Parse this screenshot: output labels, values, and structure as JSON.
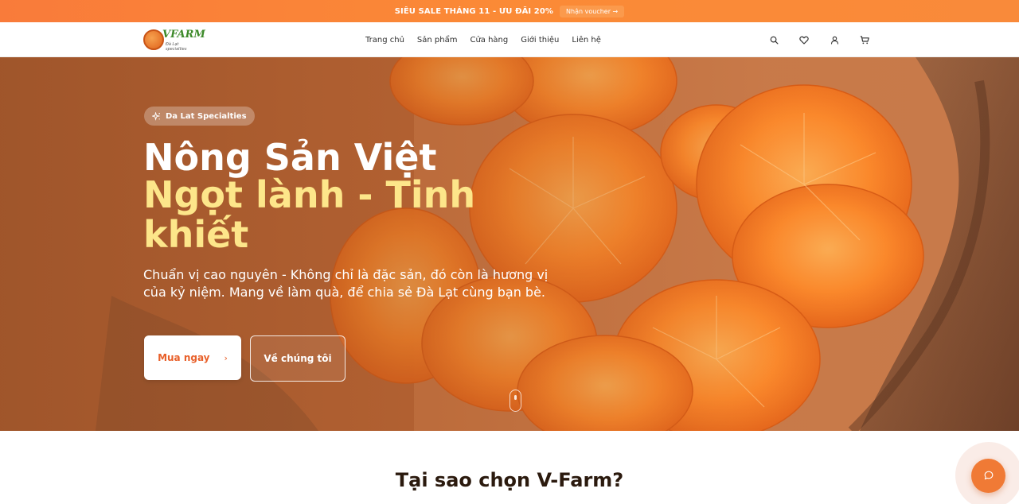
{
  "promo": {
    "text": "SIÊU SALE THÁNG 11 - ƯU ĐÃI 20%",
    "button_label": "Nhận voucher →"
  },
  "header": {
    "logo_word": "VFARM",
    "logo_sub": "Đà Lạt specialties",
    "nav": [
      "Trang chủ",
      "Sản phẩm",
      "Cửa hàng",
      "Giới thiệu",
      "Liên hệ"
    ],
    "icons": [
      "search-icon",
      "heart-icon",
      "user-icon",
      "cart-icon"
    ]
  },
  "hero": {
    "badge": "Da Lat Specialties",
    "title_line1": "Nông Sản Việt",
    "title_line2": "Ngọt lành - Tinh khiết",
    "description": "Chuẩn vị cao nguyên - Không chỉ là đặc sản, đó còn là hương vị của kỷ niệm. Mang về làm quà, để chia sẻ Đà Lạt cùng bạn bè.",
    "primary_button": "Mua ngay",
    "primary_arrow": "›",
    "secondary_button": "Về chúng tôi"
  },
  "section": {
    "title": "Tại sao chọn V-Farm?"
  },
  "colors": {
    "accent": "#f07a35",
    "promo_bg": "#fb8a36",
    "highlight": "#fde68a"
  }
}
